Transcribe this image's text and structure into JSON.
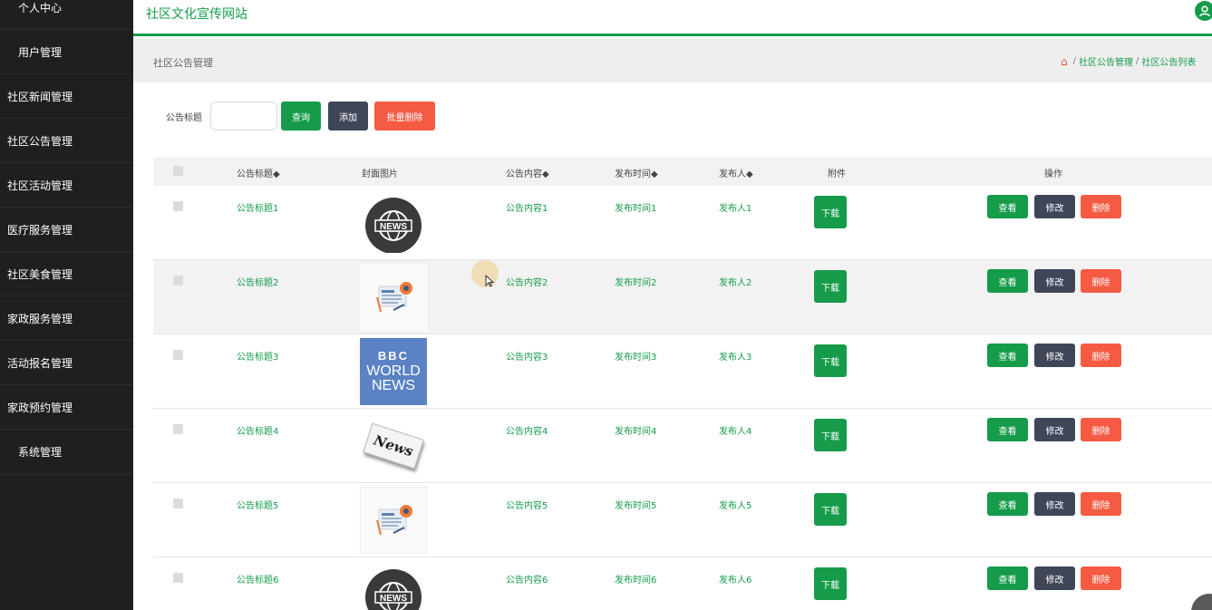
{
  "sidebar": {
    "items": [
      {
        "label": "个人中心"
      },
      {
        "label": "用户管理"
      },
      {
        "label": "社区新闻管理"
      },
      {
        "label": "社区公告管理"
      },
      {
        "label": "社区活动管理"
      },
      {
        "label": "医疗服务管理"
      },
      {
        "label": "社区美食管理"
      },
      {
        "label": "家政服务管理"
      },
      {
        "label": "活动报名管理"
      },
      {
        "label": "家政预约管理"
      },
      {
        "label": "系统管理"
      }
    ]
  },
  "header": {
    "site_title": "社区文化宣传网站",
    "user_icon": "user-icon"
  },
  "page": {
    "title": "社区公告管理",
    "breadcrumb": [
      "社区公告管理",
      "社区公告列表"
    ]
  },
  "search": {
    "label": "公告标题",
    "value": "",
    "query_label": "查询",
    "add_label": "添加",
    "batch_delete_label": "批量删除"
  },
  "table": {
    "headers": {
      "title": "公告标题◆",
      "cover": "封面图片",
      "content": "公告内容◆",
      "time": "发布时间◆",
      "publisher": "发布人◆",
      "attachment": "附件",
      "actions": "操作"
    },
    "download_label": "下载",
    "view_label": "查看",
    "edit_label": "修改",
    "delete_label": "删除",
    "rows": [
      {
        "title": "公告标题1",
        "content": "公告内容1",
        "time": "发布时间1",
        "publisher": "发布人1",
        "cover": "news-globe-icon"
      },
      {
        "title": "公告标题2",
        "content": "公告内容2",
        "time": "发布时间2",
        "publisher": "发布人2",
        "cover": "newspaper-icon"
      },
      {
        "title": "公告标题3",
        "content": "公告内容3",
        "time": "发布时间3",
        "publisher": "发布人3",
        "cover": "bbc-world-news-logo",
        "cover_text": [
          "BBC",
          "WORLD",
          "NEWS"
        ]
      },
      {
        "title": "公告标题4",
        "content": "公告内容4",
        "time": "发布时间4",
        "publisher": "发布人4",
        "cover": "news-paper-icon",
        "cover_text": [
          "News"
        ]
      },
      {
        "title": "公告标题5",
        "content": "公告内容5",
        "time": "发布时间5",
        "publisher": "发布人5",
        "cover": "newspaper-icon"
      },
      {
        "title": "公告标题6",
        "content": "公告内容6",
        "time": "发布时间6",
        "publisher": "发布人6",
        "cover": "news-globe-icon"
      }
    ]
  },
  "colors": {
    "primary": "#169b4b",
    "dark_button": "#3f4658",
    "danger": "#f55a43",
    "sidebar_bg": "#1f1f1f"
  }
}
